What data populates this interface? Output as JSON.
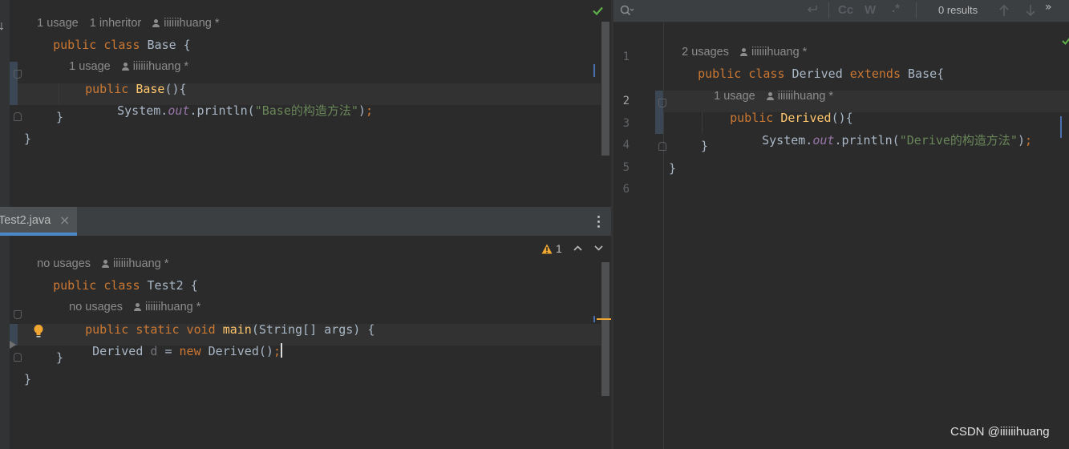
{
  "top_editor": {
    "hint_class": {
      "usages": "1 usage",
      "inheritors": "1 inheritor",
      "author": "iiiiiihuang *"
    },
    "hint_ctor": {
      "usages": "1 usage",
      "author": "iiiiiihuang *"
    },
    "lines": {
      "l1_kw": "public class",
      "l1_name": "Base",
      "l1_rest": " {",
      "l2_kw": "public",
      "l2_name": "Base",
      "l2_rest": "(){",
      "l3_a": "System.",
      "l3_field": "out",
      "l3_b": ".println(",
      "l3_str": "\"Base的构造方法\"",
      "l3_c": ")",
      "l3_semi": ";",
      "l4": "}",
      "l5": "}"
    }
  },
  "bottom_editor": {
    "tab": {
      "label": "Test2.java",
      "close": "×"
    },
    "inspection": {
      "count": "1"
    },
    "hint_class": {
      "usages": "no usages",
      "author": "iiiiiihuang *"
    },
    "hint_main": {
      "usages": "no usages",
      "author": "iiiiiihuang *"
    },
    "lines": {
      "l1_kw": "public class",
      "l1_name": " Test2 {",
      "l2_kw": "public static void",
      "l2_name": "main",
      "l2_rest": "(String[] args) {",
      "l3_a": " Derived ",
      "l3_var": "d",
      "l3_b": " = ",
      "l3_kw": "new",
      "l3_c": " Derived()",
      "l3_semi": ";",
      "l4": "}",
      "l5": "}"
    }
  },
  "right_editor": {
    "search": {
      "placeholder": "",
      "results": "0 results",
      "match_case": "Cc",
      "words": "W",
      "regex": ".*"
    },
    "hint_class": {
      "usages": "2 usages",
      "author": "iiiiiihuang *"
    },
    "hint_ctor": {
      "usages": "1 usage",
      "author": "iiiiiihuang *"
    },
    "line_numbers": [
      "1",
      "2",
      "3",
      "4",
      "5",
      "6"
    ],
    "lines": {
      "l1_kw": "public class",
      "l1_name": " Derived ",
      "l1_kw2": "extends",
      "l1_rest": " Base{",
      "l2_kw": "public",
      "l2_name": "Derived",
      "l2_rest": "(){",
      "l3_a": "System.",
      "l3_field": "out",
      "l3_b": ".println(",
      "l3_str": "\"Derive的构造方法\"",
      "l3_c": ")",
      "l3_semi": ";",
      "l4": "}",
      "l5": "}"
    }
  },
  "watermark": "CSDN @iiiiiihuang",
  "colors": {
    "keyword": "#cc7832",
    "function": "#ffc66d",
    "string": "#6a8759",
    "static_field": "#9876aa",
    "ok": "#5fb049",
    "warning": "#f0a732"
  }
}
